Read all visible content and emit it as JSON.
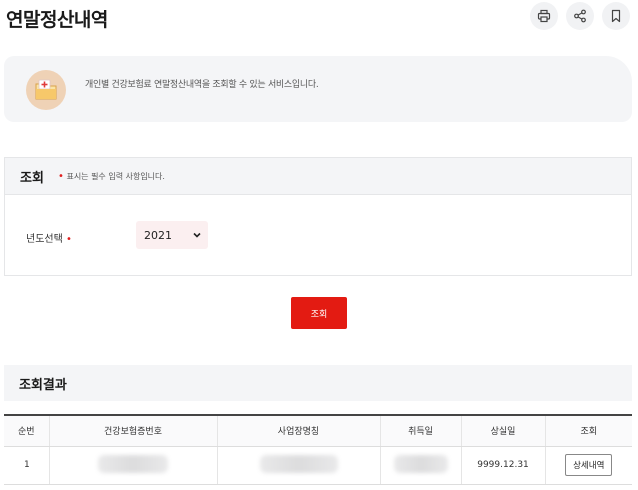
{
  "page": {
    "title": "연말정산내역"
  },
  "toolbar": {
    "icons": [
      "print-icon",
      "share-icon",
      "bookmark-icon"
    ]
  },
  "info": {
    "text": "개인별 건강보험료 연말정산내역을 조회할 수 있는 서비스입니다.",
    "icon": "folder-plus-icon"
  },
  "search": {
    "title": "조회",
    "required_dot": "•",
    "required_note": "표시는 필수 입력 사항입니다.",
    "year_label": "년도선택",
    "year_value": "2021",
    "button_label": "조회"
  },
  "results": {
    "title": "조회결과",
    "columns": [
      "순번",
      "건강보험증번호",
      "사업장명칭",
      "취득일",
      "상실일",
      "조회"
    ],
    "rows": [
      {
        "no": "1",
        "loss_date": "9999.12.31",
        "detail_label": "상세내역"
      }
    ]
  },
  "colors": {
    "accent": "#e31b12",
    "panel_bg": "#f4f5f7",
    "select_bg": "#fbeff0",
    "icon_bg": "#efd2b6"
  }
}
